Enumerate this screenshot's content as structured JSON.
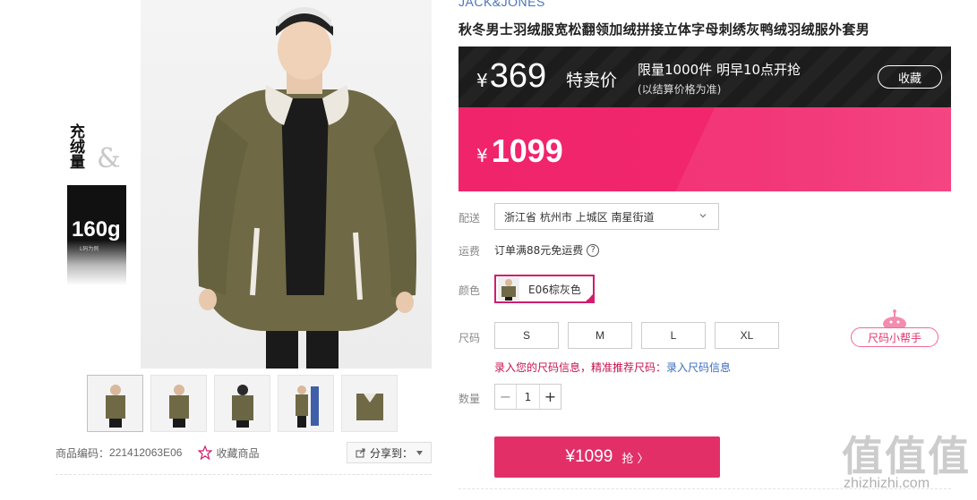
{
  "gallery": {
    "promo_vertical_text": "充绒量",
    "promo_amp": "&",
    "promo_weight": "160g",
    "promo_weight_sub": "L码为例",
    "thumbnail_count": 5
  },
  "meta": {
    "code_label": "商品编码：",
    "code_value": "221412063E06",
    "favorite_label": "收藏商品",
    "share_label": "分享到："
  },
  "product": {
    "brand": "JACK&JONES",
    "title": "秋冬男士羽绒服宽松翻领加绒拼接立体字母刺绣灰鸭绒羽绒服外套男"
  },
  "promo": {
    "currency": "¥",
    "price": "369",
    "price_label": "特卖价",
    "limit_text": "限量1000件 明早10点开抢",
    "note": "(以结算价格为准)",
    "favorite_button": "收藏"
  },
  "price": {
    "currency": "¥",
    "value": "1099"
  },
  "shipping": {
    "label": "配送",
    "location": "浙江省 杭州市 上城区 南星街道"
  },
  "freight": {
    "label": "运费",
    "text": "订单满88元免运费",
    "help_icon": "?"
  },
  "color": {
    "label": "颜色",
    "selected": "E06棕灰色"
  },
  "size": {
    "label": "尺码",
    "options": [
      "S",
      "M",
      "L",
      "XL"
    ],
    "tip": "录入您的尺码信息，精准推荐尺码：",
    "tip_link": "录入尺码信息",
    "helper": "尺码小帮手"
  },
  "quantity": {
    "label": "数量",
    "value": "1",
    "minus": "−",
    "plus": "+"
  },
  "buy": {
    "price": "¥1099",
    "action": "抢 〉"
  },
  "watermark": {
    "chars": "值值值",
    "url": "zhizhizhi.com"
  },
  "colors": {
    "accent_pink": "#f0246b",
    "buy_button": "#e22f68",
    "promo_dark": "#1c1c1c",
    "brand_blue": "#4a73b8"
  }
}
